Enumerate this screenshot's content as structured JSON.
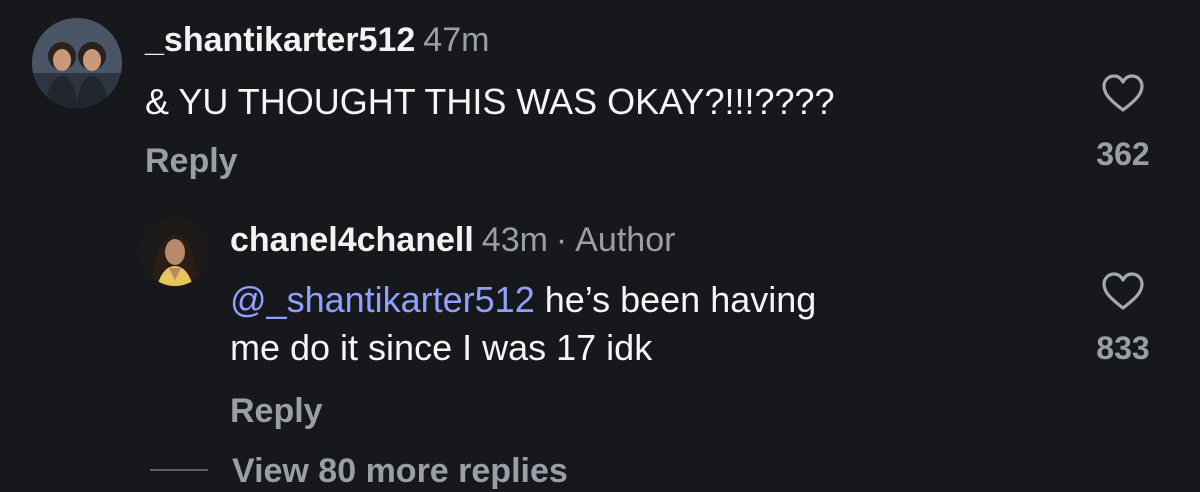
{
  "comments": [
    {
      "username": "_shantikarter512",
      "time": "47m",
      "text": "& YU THOUGHT THIS WAS OKAY?!!!????",
      "reply_label": "Reply",
      "like_count": "362",
      "like_icon": "heart-outline-icon"
    },
    {
      "username": "chanel4chanell",
      "time": "43m",
      "separator": "·",
      "role": "Author",
      "mention": "@_shantikarter512",
      "text_line1": " he’s been having",
      "text_line2": "me do it since I was 17 idk",
      "reply_label": "Reply",
      "like_count": "833",
      "like_icon": "heart-outline-icon"
    }
  ],
  "view_more": {
    "label": "View 80 more replies"
  },
  "colors": {
    "background": "#16181c",
    "text": "#f5f5f5",
    "muted": "#9a9ea6",
    "mention": "#8fa0ff"
  }
}
